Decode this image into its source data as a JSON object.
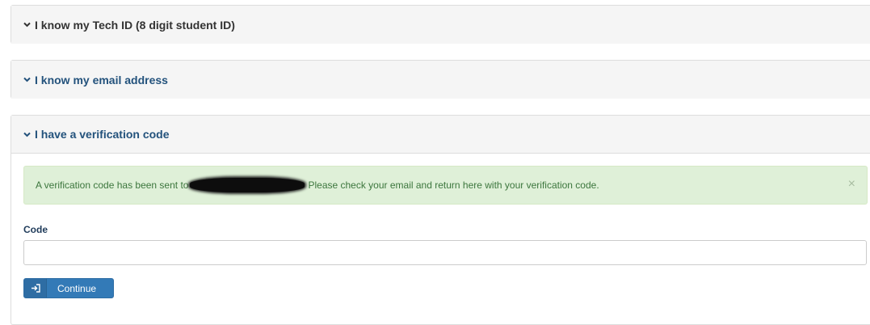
{
  "panels": {
    "techid": {
      "title": "I know my Tech ID (8 digit student ID)"
    },
    "email": {
      "title": "I know my email address"
    },
    "verify": {
      "title": "I have a verification code"
    }
  },
  "alert": {
    "message_before": "A verification code has been sent to",
    "message_after": "Please check your email and return here with your verification code.",
    "close_symbol": "×"
  },
  "code_field": {
    "label": "Code",
    "value": "",
    "placeholder": ""
  },
  "continue_button": {
    "label": "Continue",
    "icon": "sign-in-icon"
  },
  "colors": {
    "accent": "#337ab7",
    "heading_link": "#23527c",
    "alert_bg": "#dff0d8",
    "alert_text": "#3c763d"
  }
}
